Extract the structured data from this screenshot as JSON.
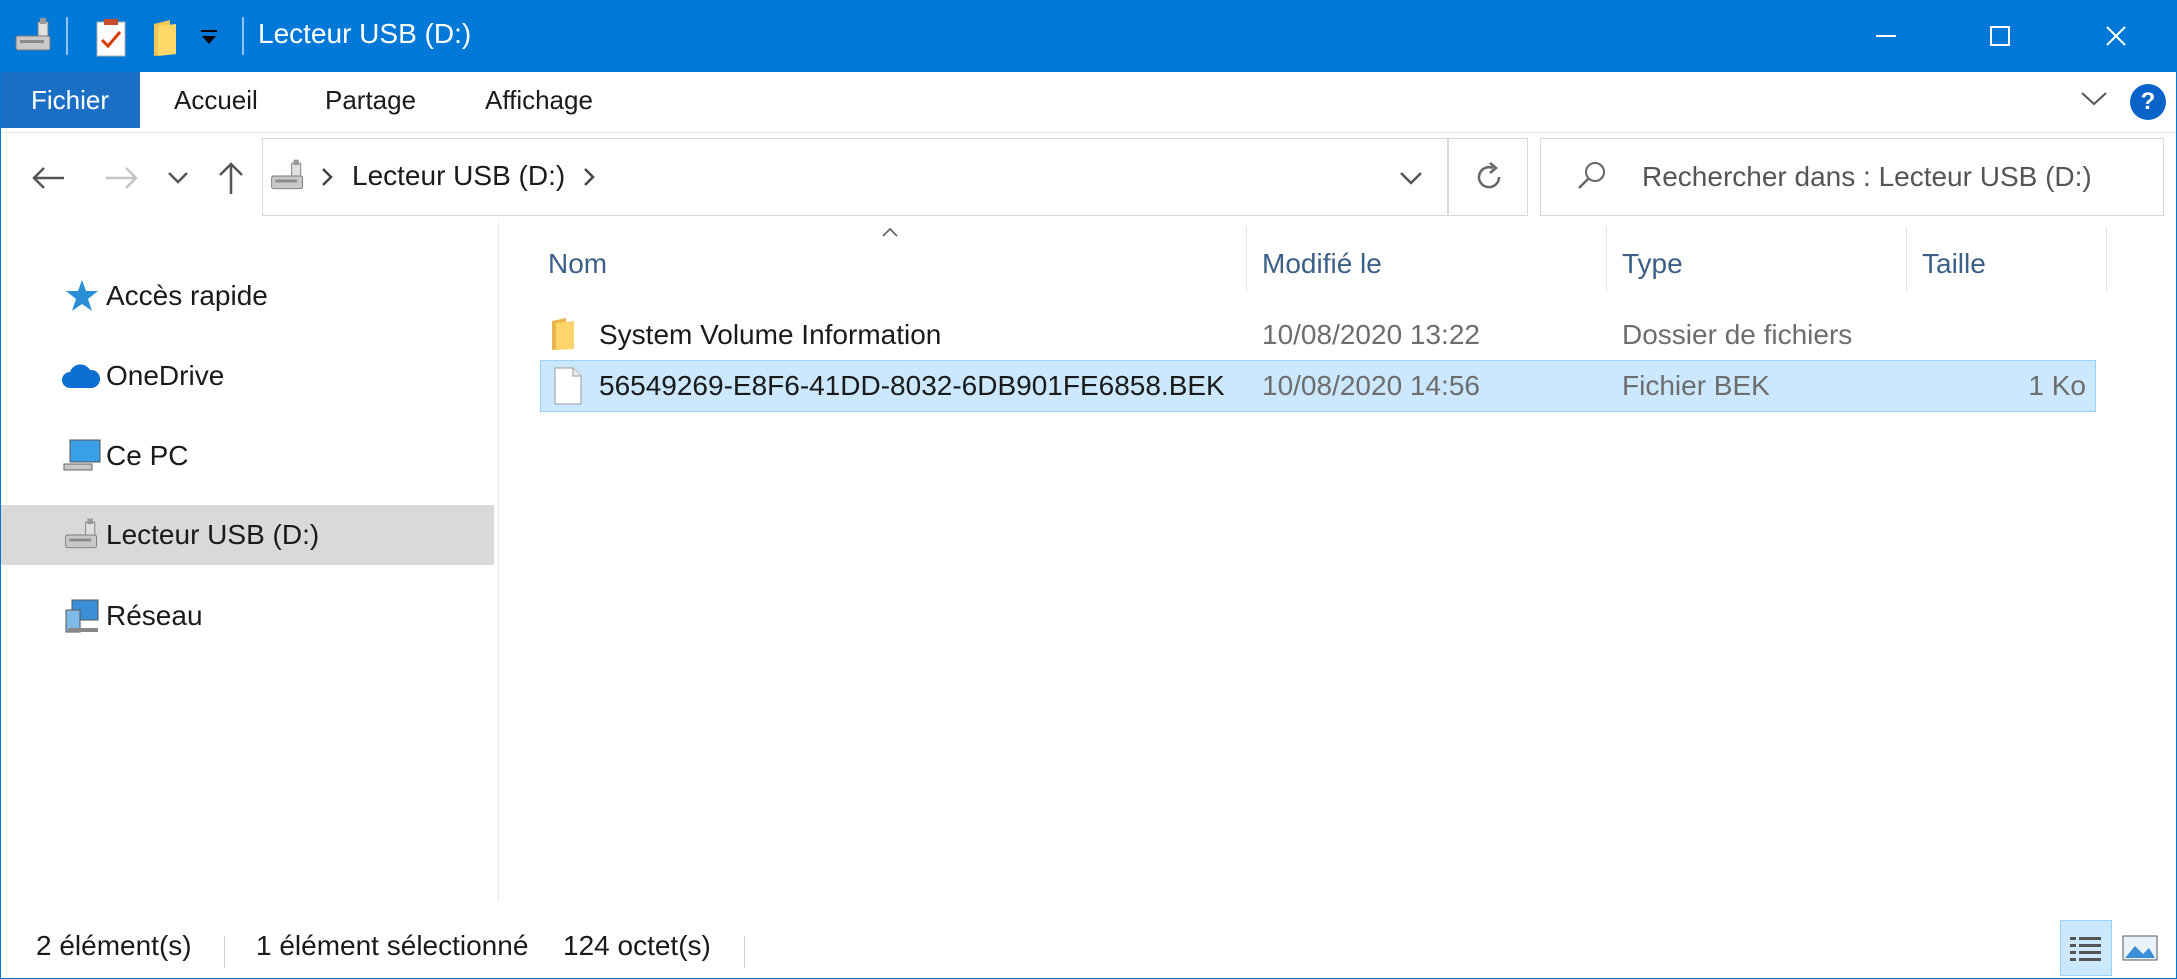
{
  "window": {
    "title": "Lecteur USB (D:)",
    "accent": "#0078d7",
    "selection_bg": "#cce8ff"
  },
  "quick_access": {
    "icons": [
      "usb-drive-icon",
      "properties-icon",
      "new-folder-icon",
      "customize-dropdown-icon"
    ]
  },
  "window_controls": {
    "minimize": "minimize-icon",
    "maximize": "maximize-icon",
    "close": "close-icon"
  },
  "ribbon": {
    "tabs": [
      "Fichier",
      "Accueil",
      "Partage",
      "Affichage"
    ],
    "help": "?"
  },
  "address_bar": {
    "location": "Lecteur USB (D:)",
    "search_placeholder": "Rechercher dans : Lecteur USB (D:)"
  },
  "nav_pane": {
    "items": [
      {
        "label": "Accès rapide",
        "icon": "star-icon",
        "selected": false
      },
      {
        "label": "OneDrive",
        "icon": "cloud-icon",
        "selected": false
      },
      {
        "label": "Ce PC",
        "icon": "computer-icon",
        "selected": false
      },
      {
        "label": "Lecteur USB (D:)",
        "icon": "usb-drive-icon",
        "selected": true
      },
      {
        "label": "Réseau",
        "icon": "network-icon",
        "selected": false
      }
    ]
  },
  "file_list": {
    "columns": [
      "Nom",
      "Modifié le",
      "Type",
      "Taille"
    ],
    "sort_column": "Nom",
    "rows": [
      {
        "name": "System Volume Information",
        "modified": "10/08/2020 13:22",
        "type": "Dossier de fichiers",
        "size": "",
        "icon": "folder-icon",
        "selected": false
      },
      {
        "name": "56549269-E8F6-41DD-8032-6DB901FE6858.BEK",
        "modified": "10/08/2020 14:56",
        "type": "Fichier BEK",
        "size": "1 Ko",
        "icon": "file-icon",
        "selected": true
      }
    ]
  },
  "status_bar": {
    "item_count": "2 élément(s)",
    "selection": "1 élément sélectionné",
    "selection_size": "124 octet(s)"
  }
}
